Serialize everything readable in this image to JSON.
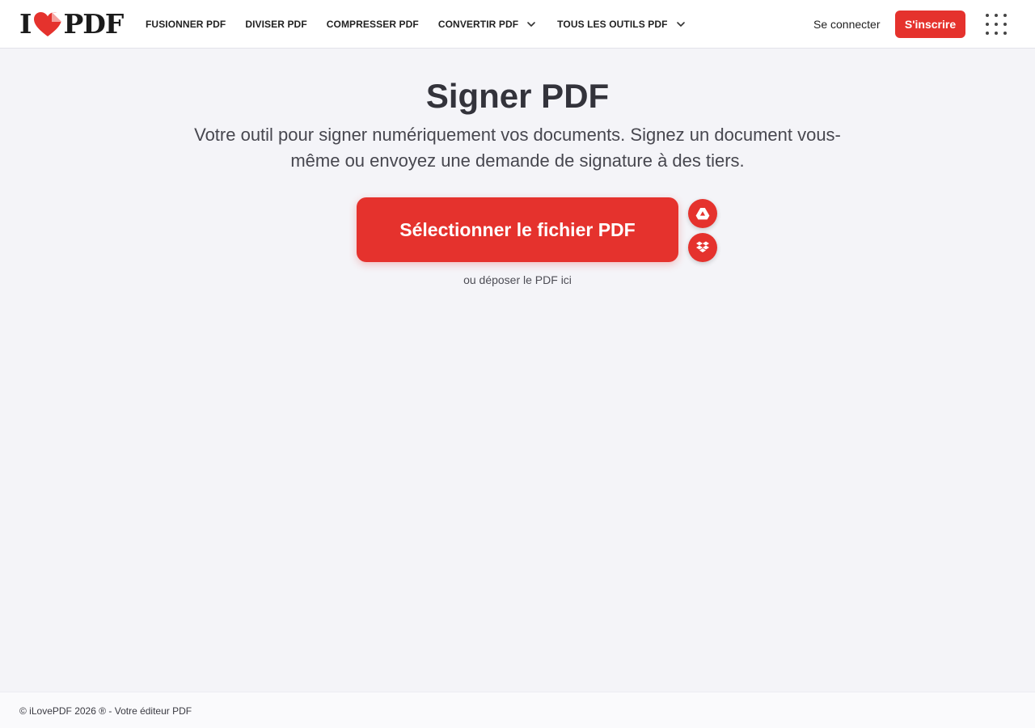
{
  "header": {
    "logo": {
      "letter_i": "I",
      "letters_pdf": "PDF",
      "icon": "heart-logo-icon"
    },
    "nav": [
      {
        "label": "FUSIONNER PDF"
      },
      {
        "label": "DIVISER PDF"
      },
      {
        "label": "COMPRESSER PDF"
      },
      {
        "label": "CONVERTIR PDF",
        "icon": "chevron-down-icon"
      },
      {
        "label": "TOUS LES OUTILS PDF",
        "icon": "chevron-down-icon"
      }
    ],
    "login_label": "Se connecter",
    "signup_label": "S'inscrire",
    "apps_icon": "apps-grid-icon"
  },
  "main": {
    "title": "Signer PDF",
    "subtitle": "Votre outil pour signer numériquement vos documents. Signez un document vous-même ou envoyez une demande de signature à des tiers.",
    "select_button_label": "Sélectionner le fichier PDF",
    "cloud_buttons": [
      {
        "icon": "google-drive-icon"
      },
      {
        "icon": "dropbox-icon"
      }
    ],
    "drop_hint": "ou déposer le PDF ici"
  },
  "footer": {
    "text": "© iLovePDF 2026 ® - Votre éditeur PDF"
  },
  "colors": {
    "brand_red": "#e5322d",
    "background": "#f4f4f8",
    "header_background": "#ffffff",
    "text_dark": "#33333b"
  }
}
